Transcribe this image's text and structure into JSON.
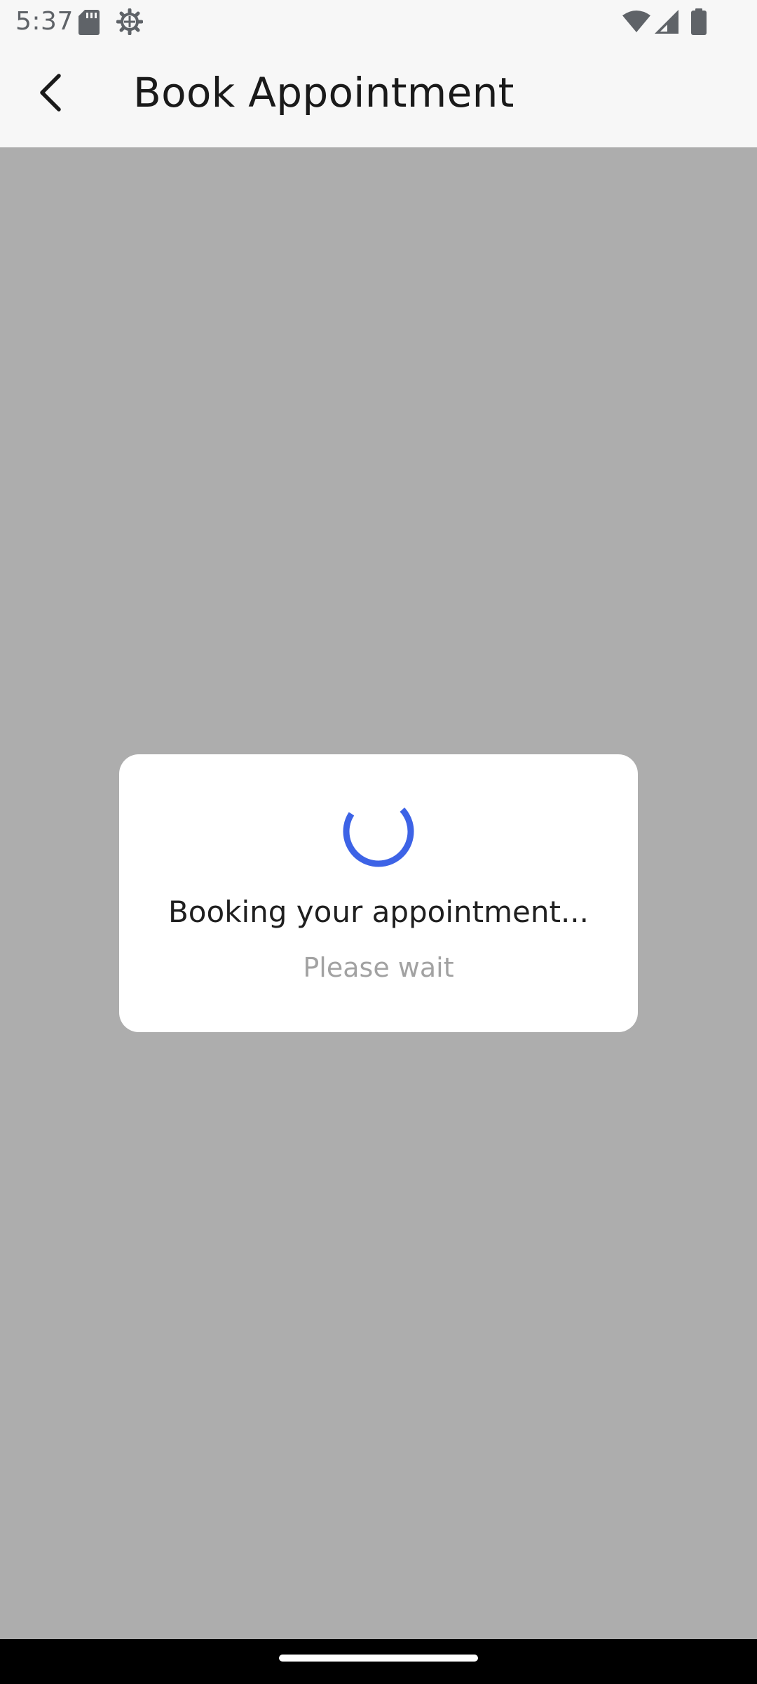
{
  "status_bar": {
    "time": "5:37",
    "left_icons": [
      "sd-card-icon",
      "settings-gear-icon"
    ],
    "right_icons": [
      "wifi-icon",
      "cell-signal-icon",
      "battery-icon"
    ]
  },
  "app_bar": {
    "back_icon": "chevron-left-icon",
    "title": "Book Appointment"
  },
  "dialog": {
    "spinner_icon": "loading-spinner-icon",
    "title": "Booking your appointment...",
    "subtitle": "Please wait"
  },
  "colors": {
    "accent": "#3d63e6",
    "overlay": "#adadad",
    "surface": "#ffffff",
    "app_bar": "#f7f7f7"
  }
}
